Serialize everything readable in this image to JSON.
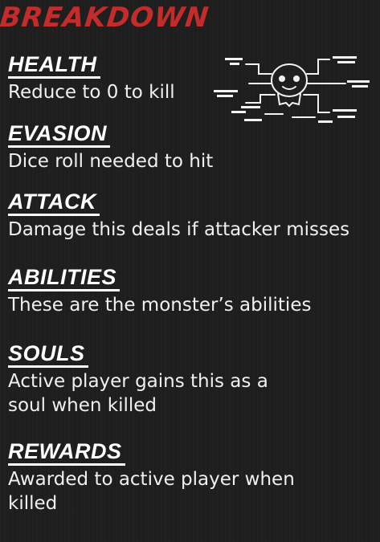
{
  "title": "Breakdown",
  "entries": [
    {
      "heading": "HEALTH",
      "description": "Reduce to 0 to kill"
    },
    {
      "heading": "EVASION",
      "description": "Dice roll needed to hit"
    },
    {
      "heading": "ATTACK",
      "description": "Damage this deals if attacker misses"
    },
    {
      "heading": "ABILITIES",
      "description": "These are the monster’s abilities"
    },
    {
      "heading": "SOULS",
      "description": "Active player gains this as a\nsoul when killed"
    },
    {
      "heading": "REWARDS",
      "description": "Awarded to active player when\nkilled"
    }
  ],
  "colors": {
    "accent": "#c42b2b",
    "background": "#1f1e1e",
    "text": "#ffffff"
  },
  "icons": {
    "diagram": "monster-skull-diagram-icon"
  }
}
